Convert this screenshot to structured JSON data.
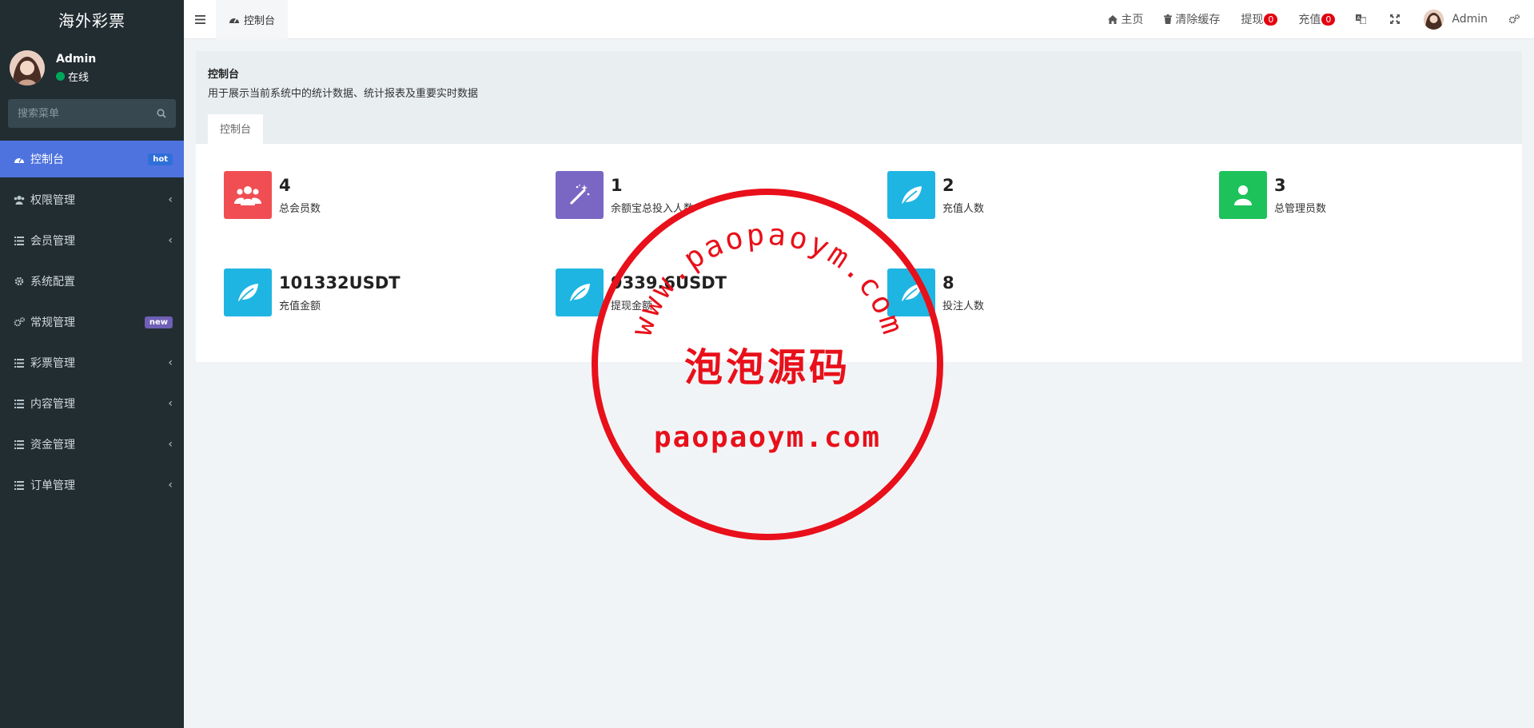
{
  "brand": "海外彩票",
  "user": {
    "name": "Admin",
    "status": "在线"
  },
  "search": {
    "placeholder": "搜索菜单"
  },
  "menu": [
    {
      "label": "控制台",
      "icon": "dashboard-icon",
      "badge": "hot",
      "active": true
    },
    {
      "label": "权限管理",
      "icon": "users-icon",
      "chevron": "‹"
    },
    {
      "label": "会员管理",
      "icon": "list-icon",
      "chevron": "‹"
    },
    {
      "label": "系统配置",
      "icon": "gear-icon"
    },
    {
      "label": "常规管理",
      "icon": "gears-icon",
      "badge": "new"
    },
    {
      "label": "彩票管理",
      "icon": "list-icon",
      "chevron": "‹"
    },
    {
      "label": "内容管理",
      "icon": "list-icon",
      "chevron": "‹"
    },
    {
      "label": "资金管理",
      "icon": "list-icon",
      "chevron": "‹"
    },
    {
      "label": "订单管理",
      "icon": "list-icon",
      "chevron": "‹"
    }
  ],
  "topbar": {
    "tab": "控制台",
    "home": "主页",
    "clear_cache": "清除缓存",
    "withdraw": "提现",
    "withdraw_count": "0",
    "recharge": "充值",
    "recharge_count": "0",
    "admin": "Admin"
  },
  "page": {
    "title": "控制台",
    "description": "用于展示当前系统中的统计数据、统计报表及重要实时数据",
    "tab": "控制台"
  },
  "stats": [
    {
      "value": "4",
      "label": "总会员数",
      "color": "#f04e53",
      "icon": "users-icon"
    },
    {
      "value": "1",
      "label": "余额宝总投入人数",
      "color": "#7a67c4",
      "icon": "magic-icon"
    },
    {
      "value": "2",
      "label": "充值人数",
      "color": "#1fb5e3",
      "icon": "leaf-icon"
    },
    {
      "value": "3",
      "label": "总管理员数",
      "color": "#1ec25a",
      "icon": "user-icon"
    },
    {
      "value": "101332USDT",
      "label": "充值金额",
      "color": "#1fb5e3",
      "icon": "leaf-icon"
    },
    {
      "value": "9339.6USDT",
      "label": "提现金额",
      "color": "#1fb5e3",
      "icon": "leaf-icon"
    },
    {
      "value": "8",
      "label": "投注人数",
      "color": "#1fb5e3",
      "icon": "leaf-icon"
    }
  ],
  "watermark": {
    "arc_text": "www.paopaoym.com",
    "center_text": "泡泡源码",
    "bottom_text": "paopaoym.com",
    "color": "#e8101a"
  }
}
